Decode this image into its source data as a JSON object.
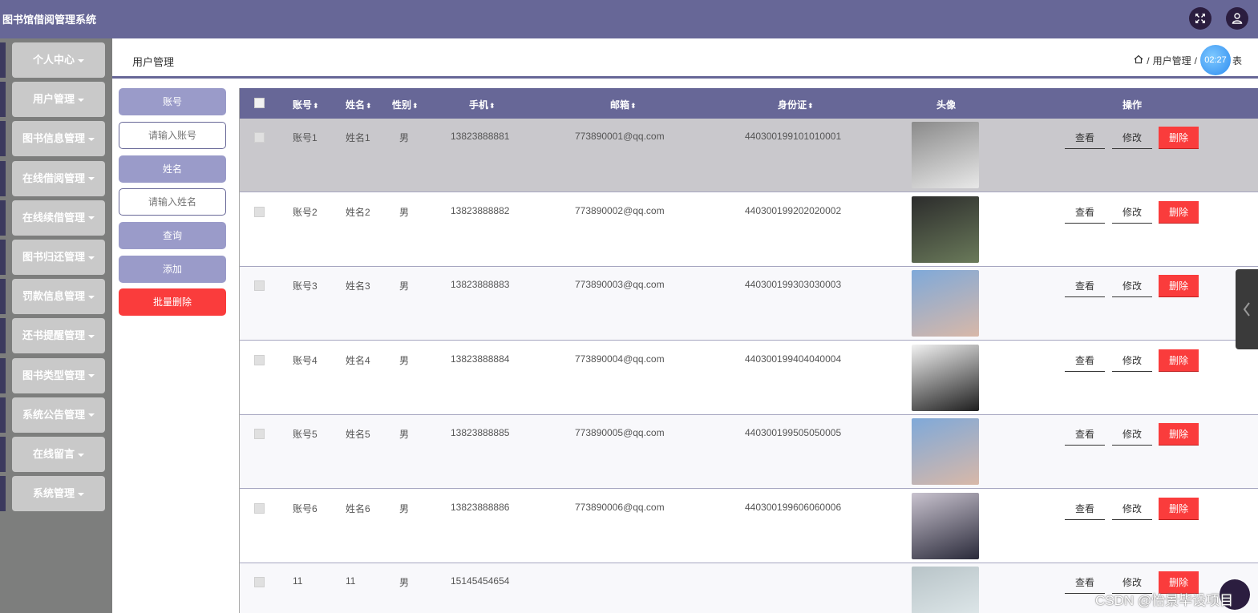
{
  "app": {
    "title": "图书馆借阅管理系统"
  },
  "topbar": {
    "fullscreen_icon": "expand-icon",
    "user_icon": "user-icon"
  },
  "sidebar": {
    "items": [
      {
        "label": "个人中心"
      },
      {
        "label": "用户管理"
      },
      {
        "label": "图书信息管理"
      },
      {
        "label": "在线借阅管理"
      },
      {
        "label": "在线续借管理"
      },
      {
        "label": "图书归还管理"
      },
      {
        "label": "罚款信息管理"
      },
      {
        "label": "还书提醒管理"
      },
      {
        "label": "图书类型管理"
      },
      {
        "label": "系统公告管理"
      },
      {
        "label": "在线留言"
      },
      {
        "label": "系统管理"
      }
    ]
  },
  "header": {
    "title": "用户管理",
    "breadcrumb": {
      "home_icon": "home-icon",
      "section": "用户管理",
      "sep": "/",
      "current": "表"
    },
    "timer": "02:27"
  },
  "search": {
    "account_label": "账号",
    "account_placeholder": "请输入账号",
    "name_label": "姓名",
    "name_placeholder": "请输入姓名",
    "query_button": "查询",
    "add_button": "添加",
    "batch_delete_button": "批量删除"
  },
  "table": {
    "columns": [
      "账号",
      "姓名",
      "性别",
      "手机",
      "邮箱",
      "身份证",
      "头像",
      "操作"
    ],
    "sort_icon": "⬍",
    "actions": {
      "view": "查看",
      "edit": "修改",
      "delete": "删除"
    },
    "rows": [
      {
        "account": "账号1",
        "name": "姓名1",
        "gender": "男",
        "phone": "13823888881",
        "email": "773890001@qq.com",
        "id_card": "440300199101010001",
        "avatar_colors": [
          "#8a8a8a",
          "#e8e8e8"
        ]
      },
      {
        "account": "账号2",
        "name": "姓名2",
        "gender": "男",
        "phone": "13823888882",
        "email": "773890002@qq.com",
        "id_card": "440300199202020002",
        "avatar_colors": [
          "#2c2c2c",
          "#6a7a5a"
        ]
      },
      {
        "account": "账号3",
        "name": "姓名3",
        "gender": "男",
        "phone": "13823888883",
        "email": "773890003@qq.com",
        "id_card": "440300199303030003",
        "avatar_colors": [
          "#7fa9d9",
          "#d8b8a8"
        ]
      },
      {
        "account": "账号4",
        "name": "姓名4",
        "gender": "男",
        "phone": "13823888884",
        "email": "773890004@qq.com",
        "id_card": "440300199404040004",
        "avatar_colors": [
          "#f2f2f2",
          "#1e1e1e"
        ]
      },
      {
        "account": "账号5",
        "name": "姓名5",
        "gender": "男",
        "phone": "13823888885",
        "email": "773890005@qq.com",
        "id_card": "440300199505050005",
        "avatar_colors": [
          "#7fa9d9",
          "#d8b8a8"
        ]
      },
      {
        "account": "账号6",
        "name": "姓名6",
        "gender": "男",
        "phone": "13823888886",
        "email": "773890006@qq.com",
        "id_card": "440300199606060006",
        "avatar_colors": [
          "#c9c3cf",
          "#2a2a3a"
        ]
      },
      {
        "account": "11",
        "name": "11",
        "gender": "男",
        "phone": "15145454654",
        "email": "",
        "id_card": "",
        "avatar_colors": [
          "#b8c4c8",
          "#e6eef0"
        ]
      }
    ]
  },
  "watermark": "CSDN @怡景毕设项目",
  "colors": {
    "primary": "#676797",
    "accent": "#9a9bc9",
    "danger": "#fa3c3c",
    "highlight_row": "#c9c8cc"
  }
}
